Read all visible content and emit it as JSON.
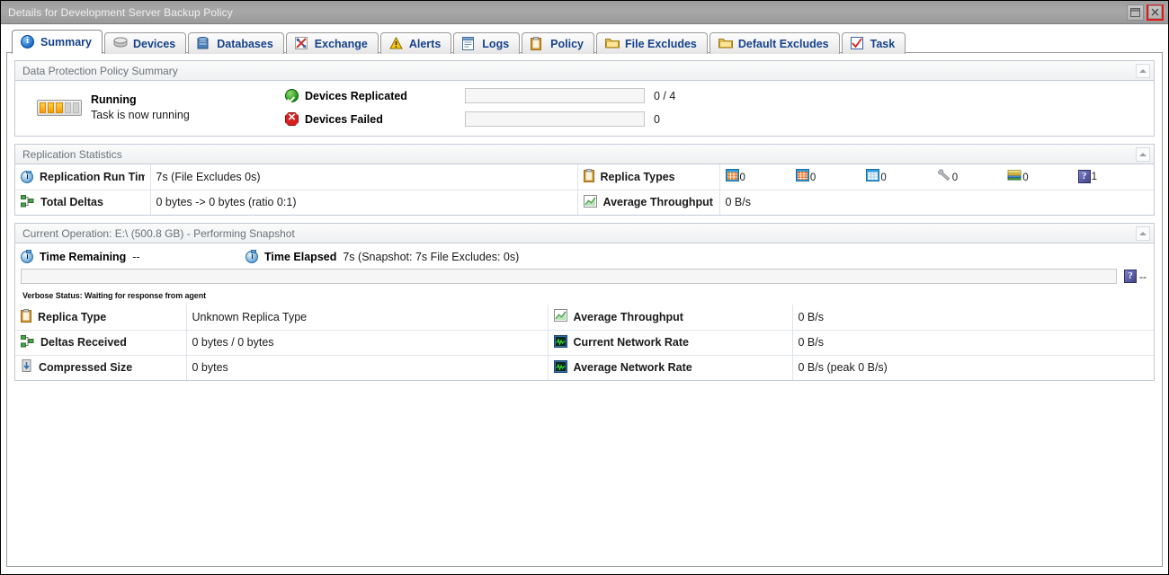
{
  "window": {
    "title": "Details for Development Server Backup Policy",
    "restore_button_label": "Restore",
    "close_button_label": "Close"
  },
  "tabs": [
    {
      "label": "Summary",
      "icon": "info-icon",
      "active": true
    },
    {
      "label": "Devices",
      "icon": "disk-icon",
      "active": false
    },
    {
      "label": "Databases",
      "icon": "database-icon",
      "active": false
    },
    {
      "label": "Exchange",
      "icon": "exchange-icon",
      "active": false
    },
    {
      "label": "Alerts",
      "icon": "warning-triangle-icon",
      "active": false
    },
    {
      "label": "Logs",
      "icon": "logs-icon",
      "active": false
    },
    {
      "label": "Policy",
      "icon": "clipboard-icon",
      "active": false
    },
    {
      "label": "File Excludes",
      "icon": "folder-icon",
      "active": false
    },
    {
      "label": "Default Excludes",
      "icon": "folder-icon",
      "active": false
    },
    {
      "label": "Task",
      "icon": "task-checkbox-icon",
      "active": false
    }
  ],
  "summary_panel": {
    "title": "Data Protection Policy Summary",
    "status": {
      "state": "Running",
      "description": "Task is now running",
      "icon": "running-progress-icon",
      "segments_filled": 3,
      "segments_total": 5
    },
    "metrics": [
      {
        "label": "Devices Replicated",
        "icon": "green-check-icon",
        "value": "0 / 4",
        "progress_percent": 0
      },
      {
        "label": "Devices Failed",
        "icon": "red-x-icon",
        "value": "0",
        "progress_percent": 0
      }
    ]
  },
  "replication_stats_panel": {
    "title": "Replication Statistics",
    "rows": [
      {
        "label": "Replication Run Time",
        "icon": "stopwatch-icon",
        "value": "7s (File Excludes 0s)"
      },
      {
        "label": "Total Deltas",
        "icon": "deltas-icon",
        "value": "0 bytes -> 0 bytes (ratio 0:1)"
      }
    ],
    "right_rows": [
      {
        "label": "Replica Types",
        "icon": "clipboard-icon",
        "chips": [
          {
            "icon": "spreadsheet-blue-icon",
            "count": "0"
          },
          {
            "icon": "spreadsheet-orange-icon",
            "count": "0"
          },
          {
            "icon": "spreadsheet-plain-icon",
            "count": "0"
          },
          {
            "icon": "wrench-icon",
            "count": "0"
          },
          {
            "icon": "stack-icon",
            "count": "0"
          },
          {
            "icon": "question-mark-icon",
            "count": "1"
          }
        ]
      },
      {
        "label": "Average Throughput",
        "icon": "chart-icon",
        "value": "0 B/s"
      }
    ]
  },
  "current_operation_panel": {
    "title": "Current Operation: E:\\ (500.8 GB) - Performing Snapshot",
    "time_remaining": {
      "label": "Time Remaining",
      "icon": "stopwatch-icon",
      "value": "--"
    },
    "time_elapsed": {
      "label": "Time Elapsed",
      "icon": "stopwatch-icon",
      "value": "7s (Snapshot: 7s File Excludes: 0s)"
    },
    "operation_progress_percent": 0,
    "operation_progress_icon": "question-mark-icon",
    "operation_progress_value": "--",
    "verbose_status": "Verbose Status: Waiting for response from agent",
    "detail_rows_left": [
      {
        "label": "Replica Type",
        "icon": "clipboard-icon",
        "value": "Unknown Replica Type"
      },
      {
        "label": "Deltas Received",
        "icon": "deltas-icon",
        "value": "0 bytes / 0 bytes"
      },
      {
        "label": "Compressed Size",
        "icon": "compress-icon",
        "value": "0 bytes"
      }
    ],
    "detail_rows_right": [
      {
        "label": "Average Throughput",
        "icon": "chart-icon",
        "value": "0 B/s"
      },
      {
        "label": "Current Network Rate",
        "icon": "network-icon",
        "value": "0 B/s"
      },
      {
        "label": "Average Network Rate",
        "icon": "network-icon",
        "value": "0 B/s (peak 0 B/s)"
      }
    ]
  },
  "colors": {
    "tab_text": "#15428b",
    "panel_header_text": "#6b7278",
    "accent_orange": "#f59a00",
    "status_ok_green": "#128a12",
    "status_fail_red": "#d42020",
    "close_highlight_red": "#e01b1b"
  }
}
